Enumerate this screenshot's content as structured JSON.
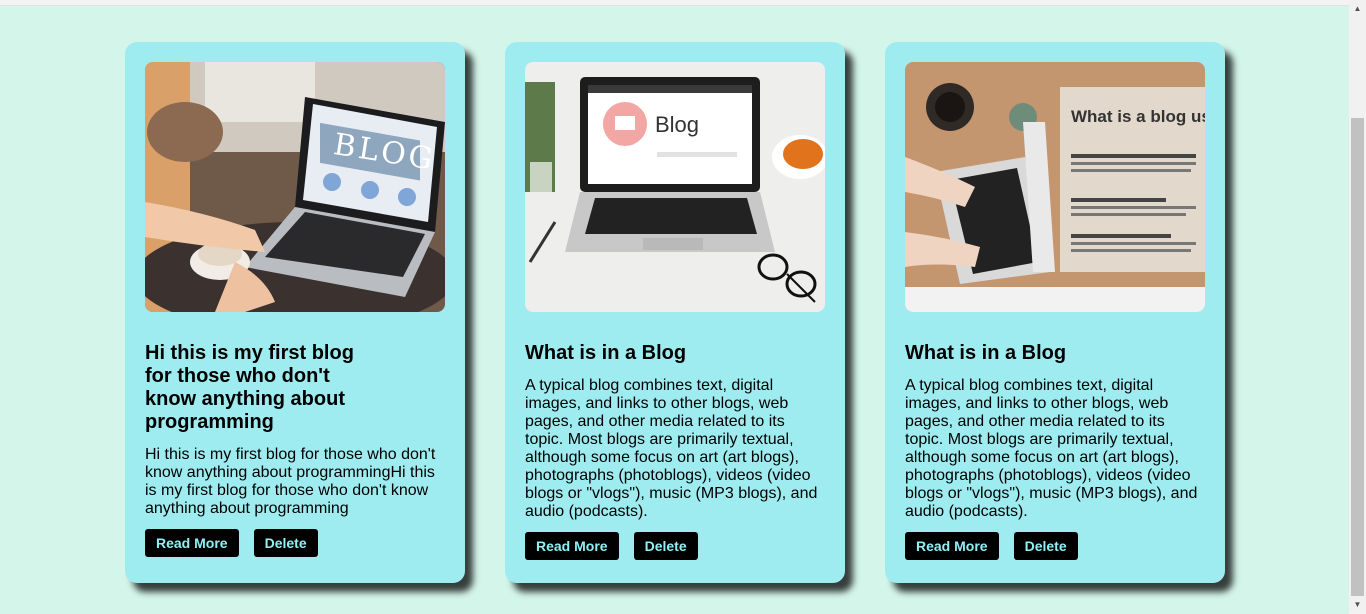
{
  "posts": [
    {
      "title": "Hi this is my first blog for those who don't know anything about programming",
      "body": "Hi this is my first blog for those who don't know anything about programmingHi this is my first blog for those who don't know anything about programming",
      "read_more": "Read More",
      "delete": "Delete",
      "image": {
        "screen_text": "BLOG"
      }
    },
    {
      "title": "What is in a Blog",
      "body": "A typical blog combines text, digital images, and links to other blogs, web pages, and other media related to its topic. Most blogs are primarily textual, although some focus on art (art blogs), photographs (photoblogs), videos (video blogs or \"vlogs\"), music (MP3 blogs), and audio (podcasts).",
      "read_more": "Read More",
      "delete": "Delete",
      "image": {
        "screen_text": "Blog"
      }
    },
    {
      "title": "What is in a Blog",
      "body": "A typical blog combines text, digital images, and links to other blogs, web pages, and other media related to its topic. Most blogs are primarily textual, although some focus on art (art blogs), photographs (photoblogs), videos (video blogs or \"vlogs\"), music (MP3 blogs), and audio (podcasts).",
      "read_more": "Read More",
      "delete": "Delete",
      "image": {
        "heading": "What is a blog used for?",
        "points": [
          {
            "head": "Connect with a wider audience.",
            "text": "Blogs connect writers and thought leaders with an online audience passionate about the same subjects."
          },
          {
            "head": "Build a business.",
            "text": "Blogging helps businesses gain credibility and improve search engine rankings."
          },
          {
            "head": "Raise awareness.",
            "text": "Many nonprofit groups use blogs to raise awareness about their cause and influence public opinion."
          }
        ]
      }
    }
  ],
  "colors": {
    "page_bg": "#d4f5ea",
    "card_bg": "#9eecf0",
    "button_bg": "#000000",
    "button_text": "#8ff0f5"
  }
}
